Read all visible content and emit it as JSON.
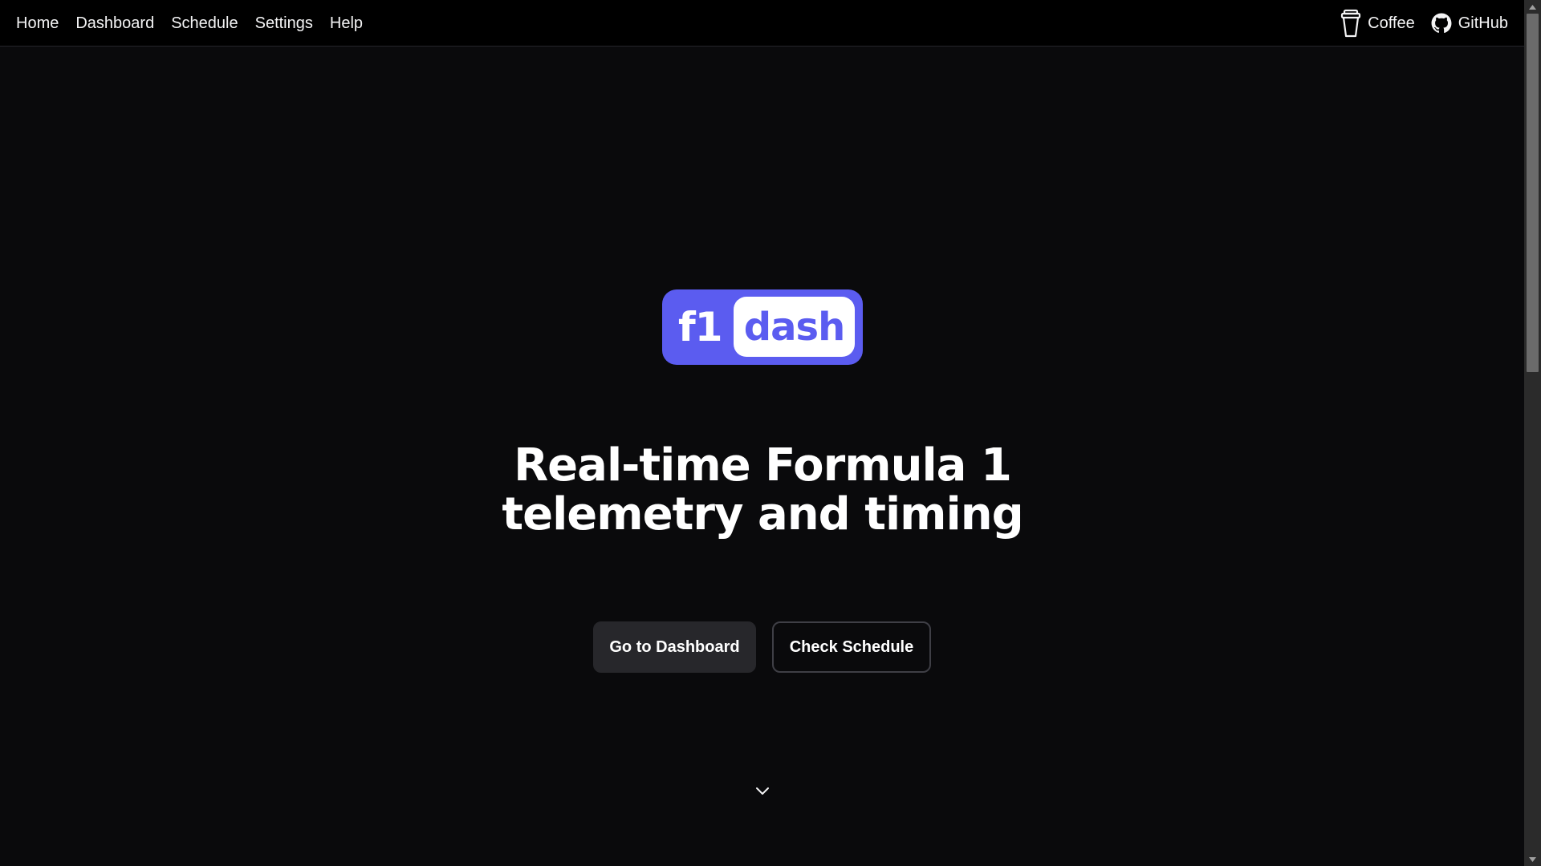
{
  "nav": {
    "links": [
      {
        "label": "Home"
      },
      {
        "label": "Dashboard"
      },
      {
        "label": "Schedule"
      },
      {
        "label": "Settings"
      },
      {
        "label": "Help"
      }
    ],
    "external": [
      {
        "label": "Coffee",
        "icon": "coffee-cup-icon"
      },
      {
        "label": "GitHub",
        "icon": "github-icon"
      }
    ]
  },
  "logo": {
    "left_text": "f1",
    "right_text": "dash",
    "brand_color": "#5b5cf0"
  },
  "hero": {
    "headline_line1": "Real-time Formula 1",
    "headline_line2": "telemetry and timing",
    "primary_button": "Go to Dashboard",
    "secondary_button": "Check Schedule",
    "scroll_icon": "chevron-down-icon"
  },
  "colors": {
    "background": "#0a0a0c",
    "nav_background": "#000000",
    "primary_button": "#27272b",
    "outline_border": "#3f3f46"
  }
}
